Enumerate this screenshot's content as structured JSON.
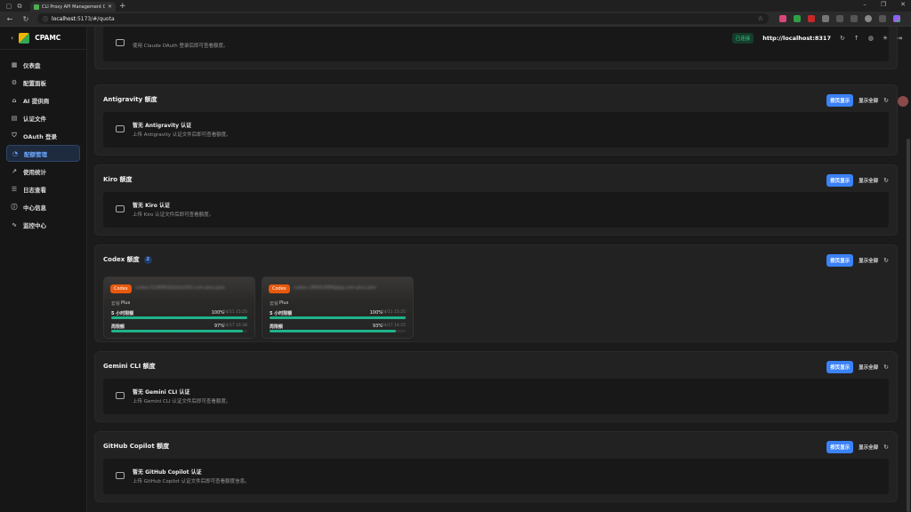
{
  "browser": {
    "tab_title": "CLI Proxy API Management Cent",
    "url_host": "localhost",
    "url_rest": ":5173/#/quota"
  },
  "app": {
    "brand": "CPAMC",
    "status": "已连接",
    "server_url": "http://localhost:8317"
  },
  "sidebar": {
    "items": [
      {
        "label": "仪表盘",
        "icon": "dashboard-icon"
      },
      {
        "label": "配置面板",
        "icon": "settings-icon"
      },
      {
        "label": "AI 提供商",
        "icon": "ai-provider-icon"
      },
      {
        "label": "认证文件",
        "icon": "file-icon"
      },
      {
        "label": "OAuth 登录",
        "icon": "shield-icon"
      },
      {
        "label": "配额管理",
        "icon": "quota-icon",
        "active": true
      },
      {
        "label": "使用统计",
        "icon": "chart-icon"
      },
      {
        "label": "日志查看",
        "icon": "log-icon"
      },
      {
        "label": "中心信息",
        "icon": "info-icon"
      },
      {
        "label": "监控中心",
        "icon": "monitor-icon"
      }
    ]
  },
  "actions": {
    "paged": "按页显示",
    "show_all": "显示全部"
  },
  "claude_partial": {
    "desc": "使用 Claude OAuth 登录后即可查看额度。"
  },
  "sections": {
    "antigravity": {
      "title": "Antigravity 额度",
      "empty_title": "暂无 Antigravity 认证",
      "empty_desc": "上传 Antigravity 认证文件后即可查看额度。"
    },
    "kiro": {
      "title": "Kiro 额度",
      "empty_title": "暂无 Kiro 认证",
      "empty_desc": "上传 Kiro 认证文件后即可查看额度。"
    },
    "codex": {
      "title": "Codex 额度",
      "count": "2"
    },
    "gemini": {
      "title": "Gemini CLI 额度",
      "empty_title": "暂无 Gemini CLI 认证",
      "empty_desc": "上传 Gemini CLI 认证文件后即可查看额度。"
    },
    "copilot": {
      "title": "GitHub Copilot 额度",
      "empty_title": "暂无 GitHub Copilot 认证",
      "empty_desc": "上传 GitHub Copilot 认证文件后即可查看额度信息。"
    }
  },
  "codex_accounts": [
    {
      "tag": "Codex",
      "email": "codex-f1289f03d2d1e163.com-plus.json",
      "plan_label": "套餐",
      "plan": "Plus",
      "quotas": [
        {
          "name": "5 小时限额",
          "pct": "100%",
          "fill": 1.0,
          "time": "04/11 15:25"
        },
        {
          "name": "周限额",
          "pct": "97%",
          "fill": 0.97,
          "time": "04/17 16:38"
        }
      ]
    },
    {
      "tag": "Codex",
      "email": "codex-c9f0414f96@qq.com-plus.json",
      "plan_label": "套餐",
      "plan": "Plus",
      "quotas": [
        {
          "name": "5 小时限额",
          "pct": "100%",
          "fill": 1.0,
          "time": "04/11 15:25"
        },
        {
          "name": "周限额",
          "pct": "93%",
          "fill": 0.93,
          "time": "04/17 14:25"
        }
      ]
    }
  ]
}
